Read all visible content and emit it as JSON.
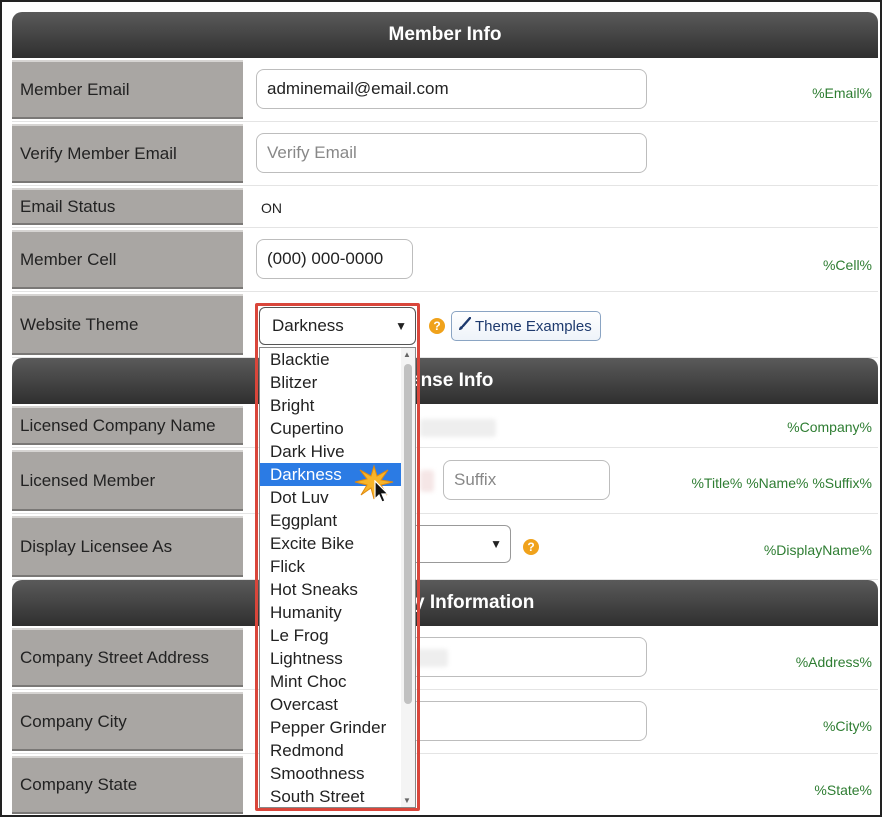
{
  "sections": {
    "member_info": "Member Info",
    "license_info_partial": "ense Info",
    "company_info_partial": "y Information"
  },
  "member": {
    "email_label": "Member Email",
    "email_value": "adminemail@email.com",
    "email_code": "%Email%",
    "verify_label": "Verify Member Email",
    "verify_placeholder": "Verify Email",
    "status_label": "Email Status",
    "status_value": "ON",
    "cell_label": "Member Cell",
    "cell_value": "(000) 000-0000",
    "cell_code": "%Cell%",
    "theme_label": "Website Theme",
    "theme_selected": "Darkness",
    "theme_examples_button": "Theme Examples"
  },
  "license": {
    "company_name_label": "Licensed Company Name",
    "company_code": "%Company%",
    "member_label": "Licensed Member",
    "suffix_placeholder": "Suffix",
    "member_code": "%Title% %Name% %Suffix%",
    "display_as_label": "Display Licensee As",
    "display_code": "%DisplayName%"
  },
  "company": {
    "street_label": "Company Street Address",
    "street_code": "%Address%",
    "city_label": "Company City",
    "city_code": "%City%",
    "state_label": "Company State",
    "state_code": "%State%"
  },
  "theme_options": [
    "Blacktie",
    "Blitzer",
    "Bright",
    "Cupertino",
    "Dark Hive",
    "Darkness",
    "Dot Luv",
    "Eggplant",
    "Excite Bike",
    "Flick",
    "Hot Sneaks",
    "Humanity",
    "Le Frog",
    "Lightness",
    "Mint Choc",
    "Overcast",
    "Pepper Grinder",
    "Redmond",
    "Smoothness",
    "South Street"
  ],
  "colors": {
    "header_bg": "#3a3a3a",
    "label_bg": "#a9a6a3",
    "code_text": "#2e7d32",
    "highlight_border": "#d9463b",
    "selected_option": "#2b7be4",
    "help_icon": "#f0a21b"
  }
}
